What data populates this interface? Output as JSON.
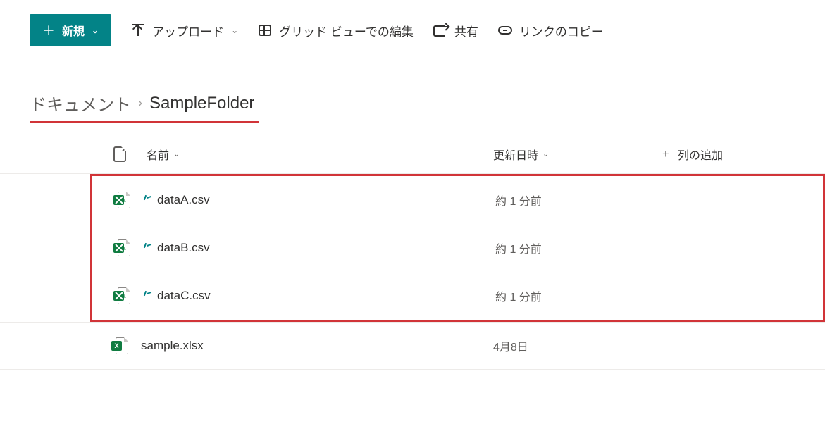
{
  "toolbar": {
    "new_label": "新規",
    "upload_label": "アップロード",
    "gridview_label": "グリッド ビューでの編集",
    "share_label": "共有",
    "copylink_label": "リンクのコピー"
  },
  "breadcrumb": {
    "root": "ドキュメント",
    "current": "SampleFolder"
  },
  "columns": {
    "name": "名前",
    "modified": "更新日時",
    "addcol": "列の追加"
  },
  "files_highlighted": [
    {
      "name": "dataA.csv",
      "modified": "約 1 分前",
      "is_new": true
    },
    {
      "name": "dataB.csv",
      "modified": "約 1 分前",
      "is_new": true
    },
    {
      "name": "dataC.csv",
      "modified": "約 1 分前",
      "is_new": true
    }
  ],
  "files_other": [
    {
      "name": "sample.xlsx",
      "modified": "4月8日",
      "is_new": false
    }
  ]
}
